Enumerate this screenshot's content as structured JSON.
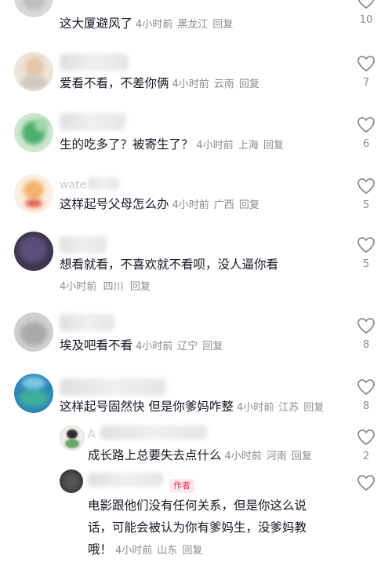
{
  "comments": [
    {
      "text": "这大厦避风了",
      "time": "4小时前",
      "location": "黑龙江",
      "reply": "回复",
      "likes": "10"
    },
    {
      "text": "爱看不看，不差你俩",
      "time": "4小时前",
      "location": "云南",
      "reply": "回复",
      "likes": "7"
    },
    {
      "text": "生的吃多了？被寄生了？",
      "time": "4小时前",
      "location": "上海",
      "reply": "回复",
      "likes": "6"
    },
    {
      "text": "这样起号父母怎么办",
      "time": "4小时前",
      "location": "广西",
      "reply": "回复",
      "likes": "5",
      "name_partial": "wate"
    },
    {
      "text": "想看就看，不喜欢就不看呗，没人逼你看",
      "time": "4小时前",
      "location": "四川",
      "reply": "回复",
      "likes": "5"
    },
    {
      "text": "埃及吧看不看",
      "time": "4小时前",
      "location": "辽宁",
      "reply": "回复",
      "likes": "8"
    },
    {
      "text": "这样起号固然快 但是你爹妈咋整",
      "time": "4小时前",
      "location": "江苏",
      "reply": "回复",
      "likes": "8"
    }
  ],
  "replies": [
    {
      "text": "成长路上总要失去点什么",
      "time": "4小时前",
      "location": "河南",
      "reply": "回复",
      "likes": "2",
      "name_partial": "A"
    },
    {
      "author_tag": "作者",
      "line1": "电影跟他们没有任何关系，但是你这么说",
      "line2": "话，可能会被认为你有爹妈生，没爹妈教",
      "line3": "哦！",
      "time": "4小时前",
      "location": "山东",
      "reply": "回复"
    }
  ]
}
